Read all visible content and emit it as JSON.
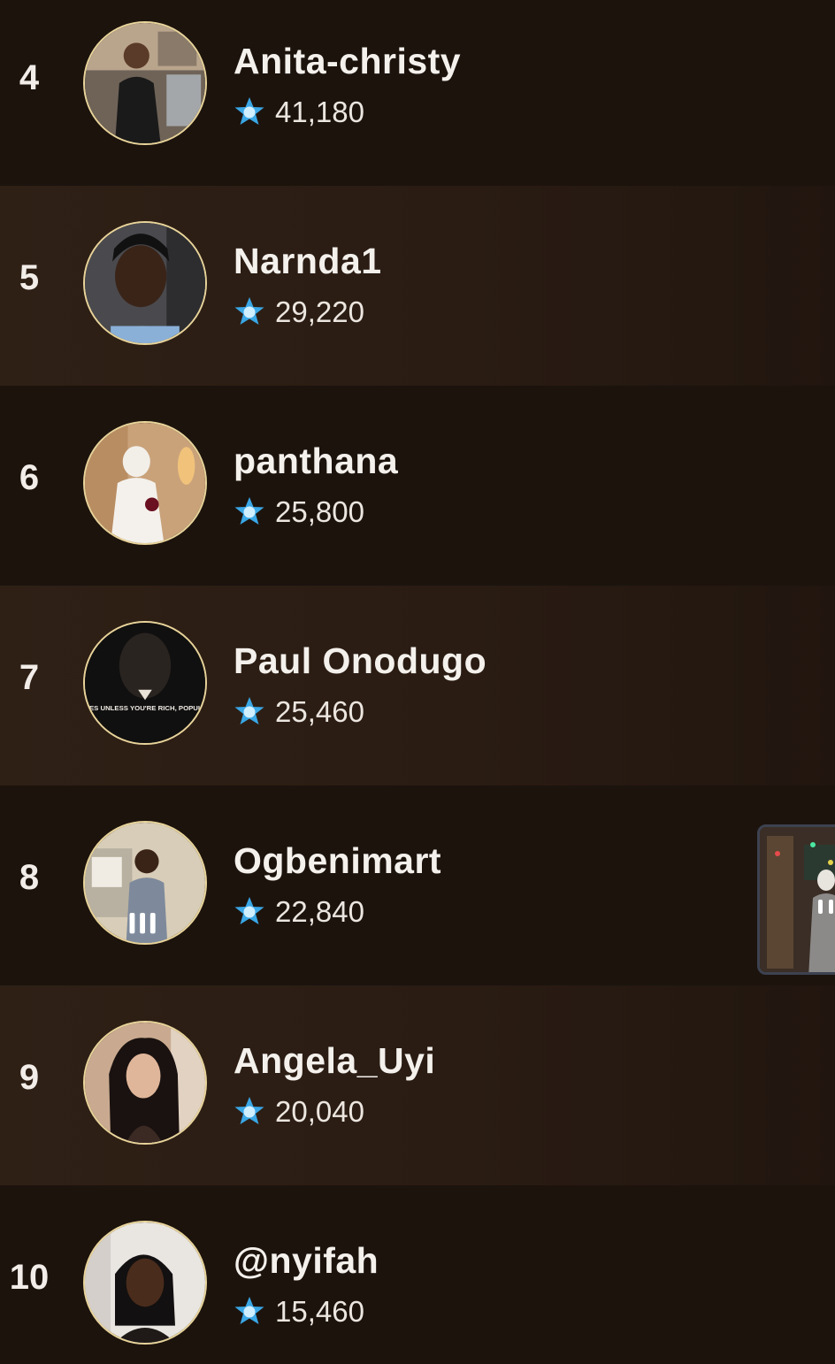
{
  "leaderboard": {
    "entries": [
      {
        "rank": "4",
        "name": "Anita-christy",
        "score": "41,180"
      },
      {
        "rank": "5",
        "name": "Narnda1",
        "score": "29,220"
      },
      {
        "rank": "6",
        "name": "panthana",
        "score": "25,800"
      },
      {
        "rank": "7",
        "name": "Paul Onodugo",
        "score": "25,460"
      },
      {
        "rank": "8",
        "name": "Ogbenimart",
        "score": "22,840"
      },
      {
        "rank": "9",
        "name": "Angela_Uyi",
        "score": "20,040"
      },
      {
        "rank": "10",
        "name": "@nyifah",
        "score": "15,460"
      }
    ],
    "score_icon": "star-coin-icon",
    "avatar_captions": {
      "paul_onodugo": "NOBODY CARES UNLESS YOU'RE RICH, POPULAR OR DEAD."
    }
  },
  "colors": {
    "background": "#1c130d",
    "row_alt": "#2f2016",
    "avatar_border": "#e8d49a",
    "coin_blue": "#3aa7e6",
    "text": "#f4f0ec"
  }
}
